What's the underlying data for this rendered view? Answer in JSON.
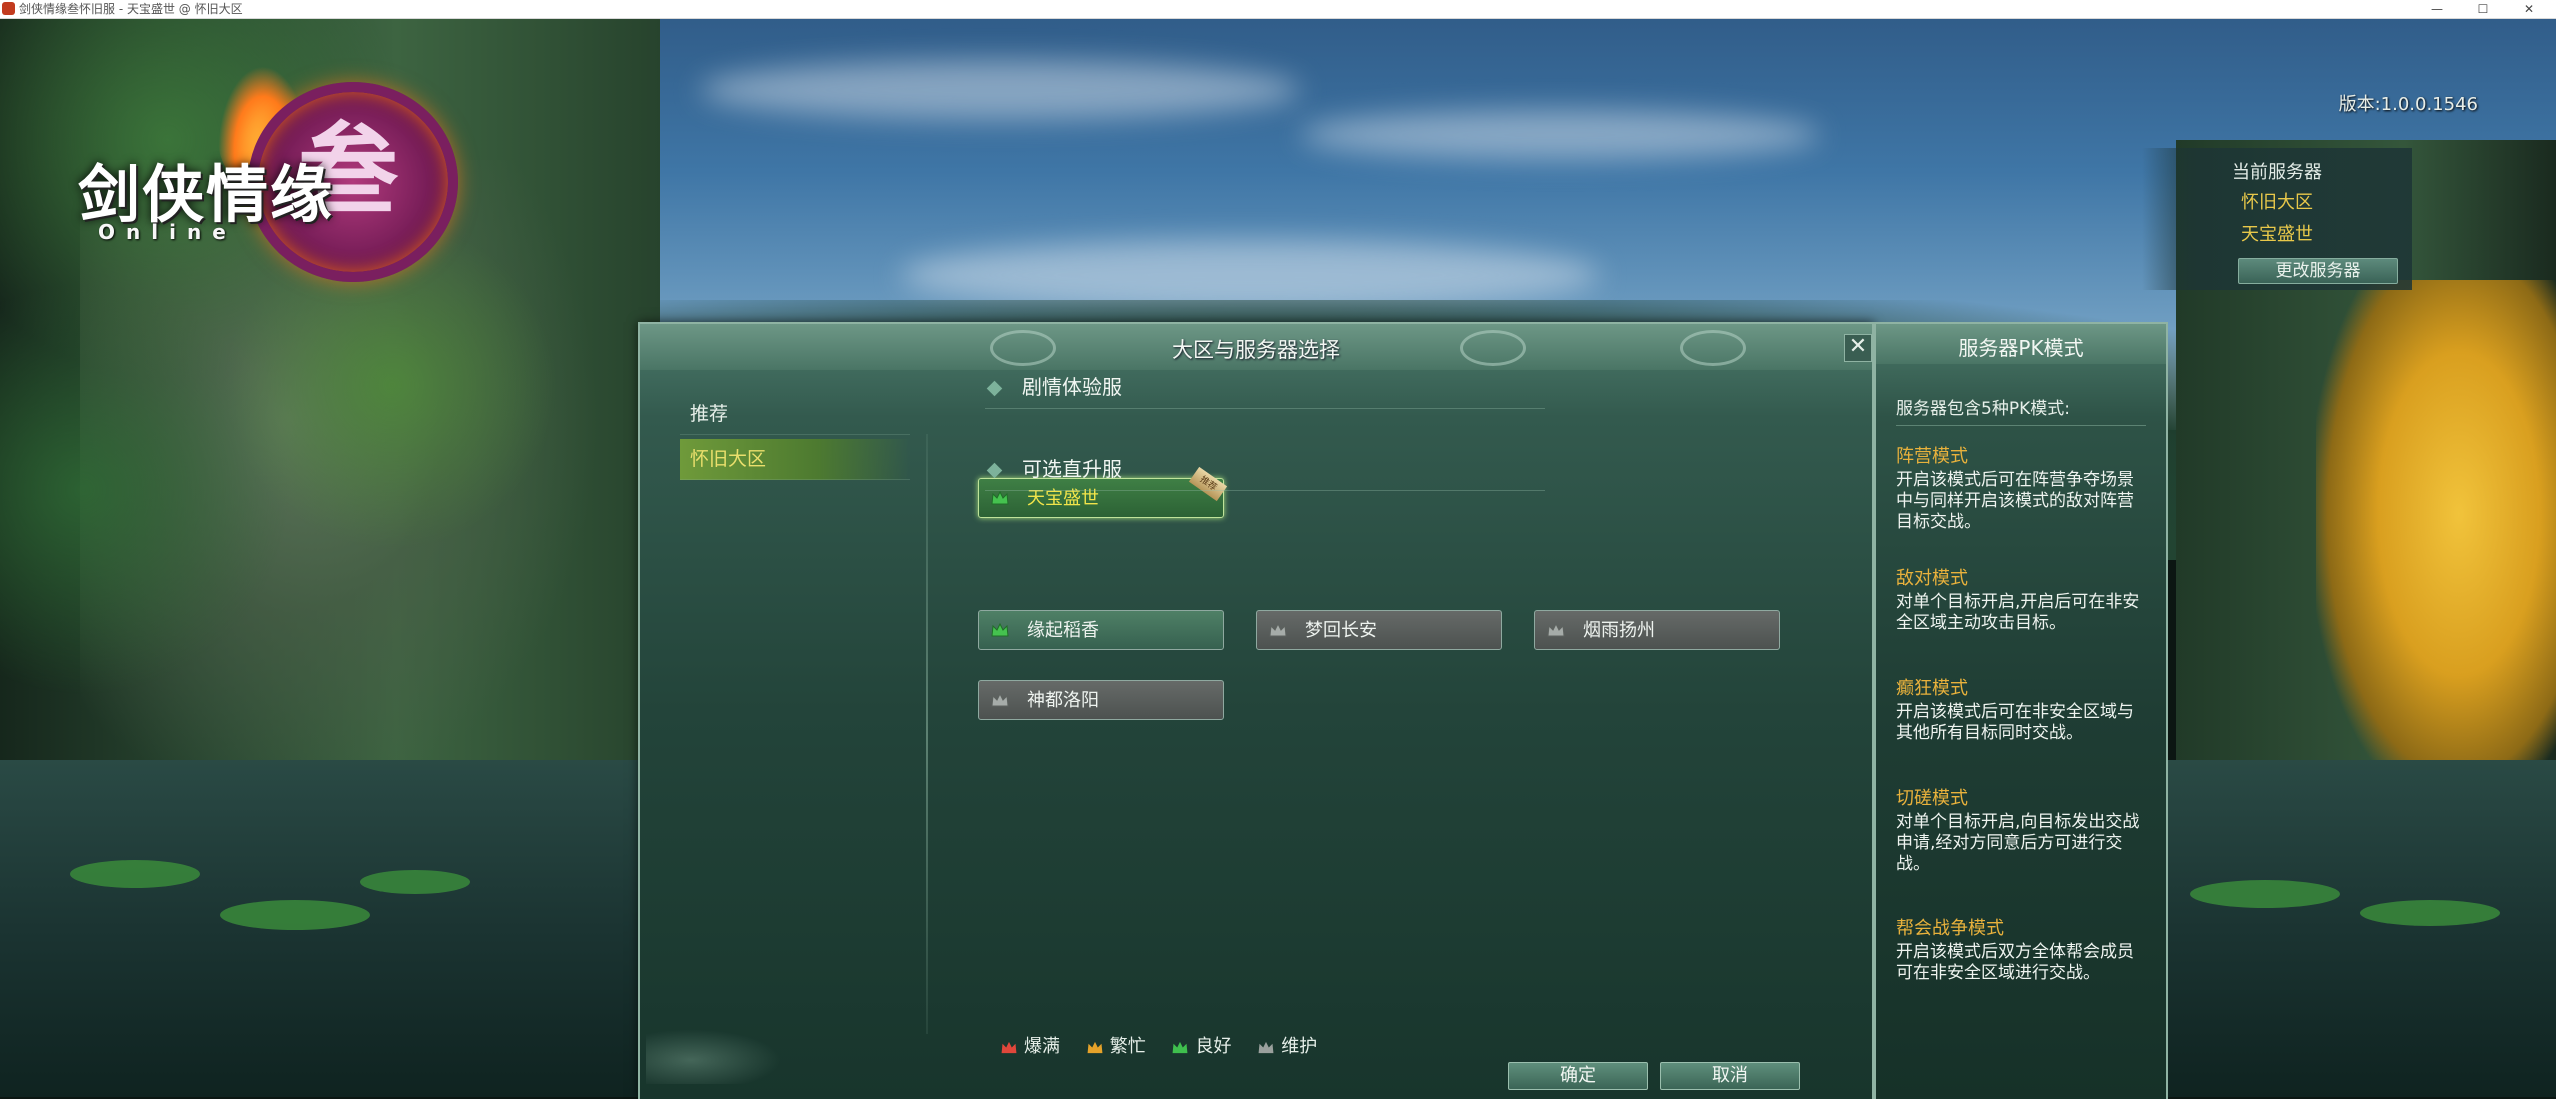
{
  "window": {
    "title": "剑侠情缘叁怀旧服 - 天宝盛世 @ 怀旧大区",
    "min": "—",
    "max": "☐",
    "close": "✕"
  },
  "logo": {
    "main": "剑侠情缘",
    "ring_char": "叁",
    "sub": "Online"
  },
  "version": "版本:1.0.0.1546",
  "current_server": {
    "label": "当前服务器",
    "zone": "怀旧大区",
    "server": "天宝盛世",
    "change_button": "更改服务器"
  },
  "dialog": {
    "title": "大区与服务器选择",
    "close": "✕",
    "zones": [
      {
        "label": "推荐"
      },
      {
        "label": "怀旧大区"
      }
    ],
    "sections": [
      {
        "title": "剧情体验服"
      },
      {
        "title": "可选直升服"
      }
    ],
    "story_servers": [
      {
        "name": "天宝盛世",
        "status": "selected",
        "tag": "推荐"
      }
    ],
    "direct_servers": [
      {
        "name": "缘起稻香",
        "status": "good"
      },
      {
        "name": "梦回长安",
        "status": "maint"
      },
      {
        "name": "烟雨扬州",
        "status": "maint"
      },
      {
        "name": "神都洛阳",
        "status": "maint"
      }
    ],
    "legend": [
      {
        "label": "爆满",
        "color": "#e0473b"
      },
      {
        "label": "繁忙",
        "color": "#e5a22a"
      },
      {
        "label": "良好",
        "color": "#3fbf4e"
      },
      {
        "label": "维护",
        "color": "#9aa09d"
      }
    ],
    "confirm": "确定",
    "cancel": "取消"
  },
  "pk_panel": {
    "title": "服务器PK模式",
    "intro": "服务器包含5种PK模式:",
    "modes": [
      {
        "name": "阵营模式",
        "desc": "开启该模式后可在阵营争夺场景中与同样开启该模式的敌对阵营目标交战。"
      },
      {
        "name": "敌对模式",
        "desc": "对单个目标开启,开启后可在非安全区域主动攻击目标。"
      },
      {
        "name": "癫狂模式",
        "desc": "开启该模式后可在非安全区域与其他所有目标同时交战。"
      },
      {
        "name": "切磋模式",
        "desc": "对单个目标开启,向目标发出交战申请,经对方同意后方可进行交战。"
      },
      {
        "name": "帮会战争模式",
        "desc": "开启该模式后双方全体帮会成员可在非安全区域进行交战。"
      }
    ]
  }
}
